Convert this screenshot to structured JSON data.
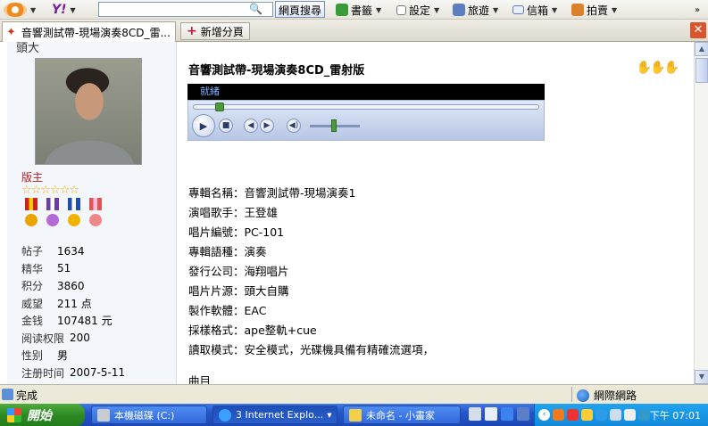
{
  "toolbar": {
    "search_placeholder": "",
    "web_search": "網頁搜尋",
    "bookmarks": "書籤",
    "settings": "設定",
    "travel": "旅遊",
    "mail": "信箱",
    "auction": "拍賣"
  },
  "tabs": {
    "active": "音響測試帶-現場演奏8CD_雷...",
    "new_tab": "新增分頁"
  },
  "sidebar": {
    "header": "頭大",
    "rank": "版主",
    "stars": "☆☆☆☆☆☆",
    "stats": [
      {
        "k": "帖子",
        "v": "1634"
      },
      {
        "k": "精华",
        "v": "51"
      },
      {
        "k": "积分",
        "v": "3860"
      },
      {
        "k": "威望",
        "v": "211 点"
      },
      {
        "k": "金钱",
        "v": "107481 元"
      },
      {
        "k": "阅读权限",
        "v": "200"
      },
      {
        "k": "性别",
        "v": "男"
      },
      {
        "k": "注册时间",
        "v": "2007-5-11"
      }
    ]
  },
  "post": {
    "title": "音響測試帶-現場演奏8CD_雷射版",
    "player_status": "就緒",
    "info": [
      "專輯名稱：音響測試帶-現場演奏1",
      "演唱歌手：王登雄",
      "唱片編號：PC-101",
      "專輯語種：演奏",
      "發行公司：海翔唱片",
      "唱片片源：頭大自購",
      "製作軟體：EAC",
      "採樣格式：ape整軌+cue",
      "讀取模式：安全模式，光碟機具備有精確流選項，"
    ],
    "tracklist_head": "曲目"
  },
  "status": {
    "text": "完成",
    "zone": "網際網路"
  },
  "taskbar": {
    "start": "開始",
    "tasks": [
      "本機磁碟 (C:)",
      "3 Internet Explo...",
      "未命名 - 小畫家"
    ],
    "clock": "下午 07:01"
  }
}
